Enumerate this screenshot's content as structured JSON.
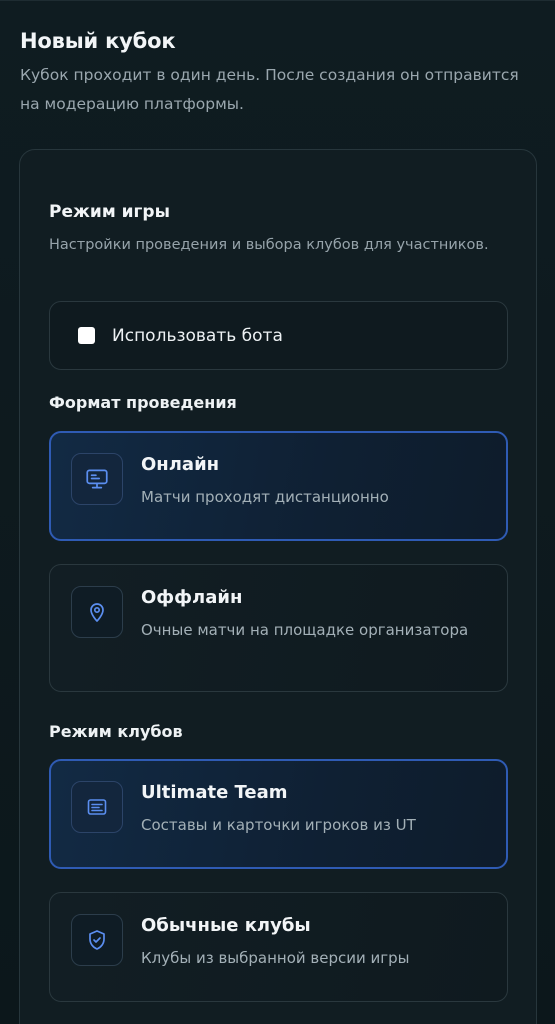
{
  "header": {
    "title": "Новый кубок",
    "subtitle": "Кубок проходит в один день. После создания он отправится на модерацию платформы."
  },
  "game_mode": {
    "title": "Режим игры",
    "description": "Настройки проведения и выбора клубов для участников.",
    "use_bot": {
      "label": "Использовать бота",
      "checked": false
    }
  },
  "format": {
    "label": "Формат проведения",
    "options": [
      {
        "title": "Онлайн",
        "description": "Матчи проходят дистанционно",
        "icon": "monitor-icon",
        "selected": true
      },
      {
        "title": "Оффлайн",
        "description": "Очные матчи на площадке организатора",
        "icon": "map-pin-icon",
        "selected": false
      }
    ]
  },
  "club_mode": {
    "label": "Режим клубов",
    "options": [
      {
        "title": "Ultimate Team",
        "description": "Составы и карточки игроков из UT",
        "icon": "card-icon",
        "selected": true
      },
      {
        "title": "Обычные клубы",
        "description": "Клубы из выбранной версии игры",
        "icon": "shield-check-icon",
        "selected": false
      }
    ]
  },
  "colors": {
    "accent": "#2f5bb4",
    "icon_blue": "#5b8ef0",
    "background": "#0e1a1f"
  }
}
